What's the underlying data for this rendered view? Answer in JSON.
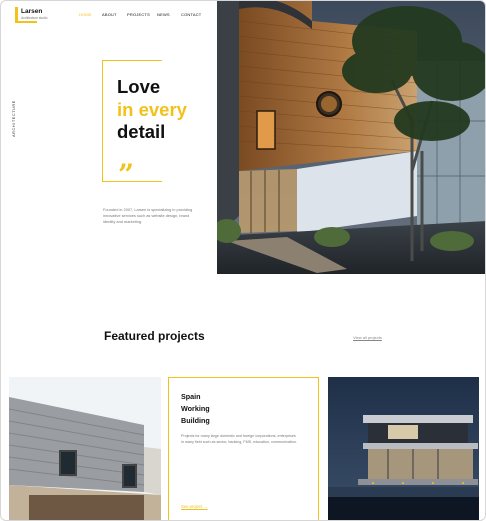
{
  "brand": {
    "name": "Larsen",
    "tagline": "Architecture studio"
  },
  "nav": [
    {
      "label": "HOME",
      "active": true
    },
    {
      "label": "ABOUT",
      "active": false
    },
    {
      "label": "PROJECTS",
      "active": false
    },
    {
      "label": "NEWS",
      "active": false
    },
    {
      "label": "CONTACT",
      "active": false
    }
  ],
  "sidebar_label": "ARCHITECTURE",
  "hero": {
    "title_line1": "Love",
    "title_line2": "in every",
    "title_line3": "detail",
    "quote_glyph": "”",
    "description": "Founded in 2007, Larsen is specializing in providing innovative services such as website design, brand identity and marketing."
  },
  "featured": {
    "title": "Featured projects",
    "view_all": "View all projects",
    "card": {
      "title_line1": "Spain",
      "title_line2": "Working",
      "title_line3": "Building",
      "description": "Projects for many large domestic and foreign corporations, enterprises in many field such as sector, banking, FMS, education, communication.",
      "link": "See project  →"
    }
  },
  "colors": {
    "accent": "#f2c21b",
    "text": "#111111",
    "muted": "#777777"
  }
}
